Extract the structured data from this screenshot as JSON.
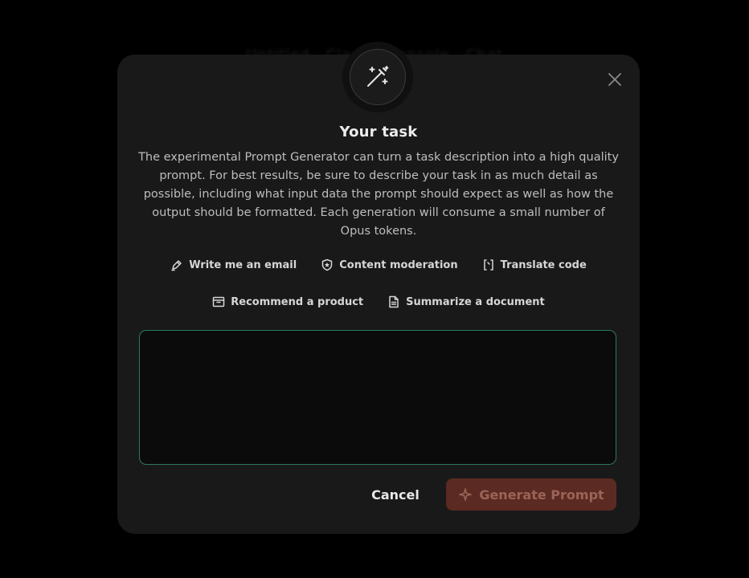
{
  "background": {
    "ghost_text": "Untitled  ·  Claude Console  ·  Chat"
  },
  "modal": {
    "badge_icon": "magic-wand-icon",
    "close_icon": "close-icon",
    "title": "Your task",
    "description": "The experimental Prompt Generator can turn a task description into a high quality prompt. For best results, be sure to describe your task in as much detail as possible, including what input data the prompt should expect as well as how the output should be formatted. Each generation will consume a small number of Opus tokens.",
    "examples": [
      {
        "label": "Write me an email",
        "icon": "pen-icon"
      },
      {
        "label": "Content moderation",
        "icon": "shield-icon"
      },
      {
        "label": "Translate code",
        "icon": "code-brackets-icon"
      },
      {
        "label": "Recommend a product",
        "icon": "box-icon"
      },
      {
        "label": "Summarize a document",
        "icon": "document-icon"
      }
    ],
    "task_input": {
      "value": "",
      "placeholder": ""
    },
    "cancel_label": "Cancel",
    "generate_label": "Generate Prompt",
    "generate_icon": "sparkle-icon"
  },
  "colors": {
    "accent_border": "#2d7a5c",
    "generate_bg": "#5b2a22",
    "generate_text": "#9a6458"
  }
}
